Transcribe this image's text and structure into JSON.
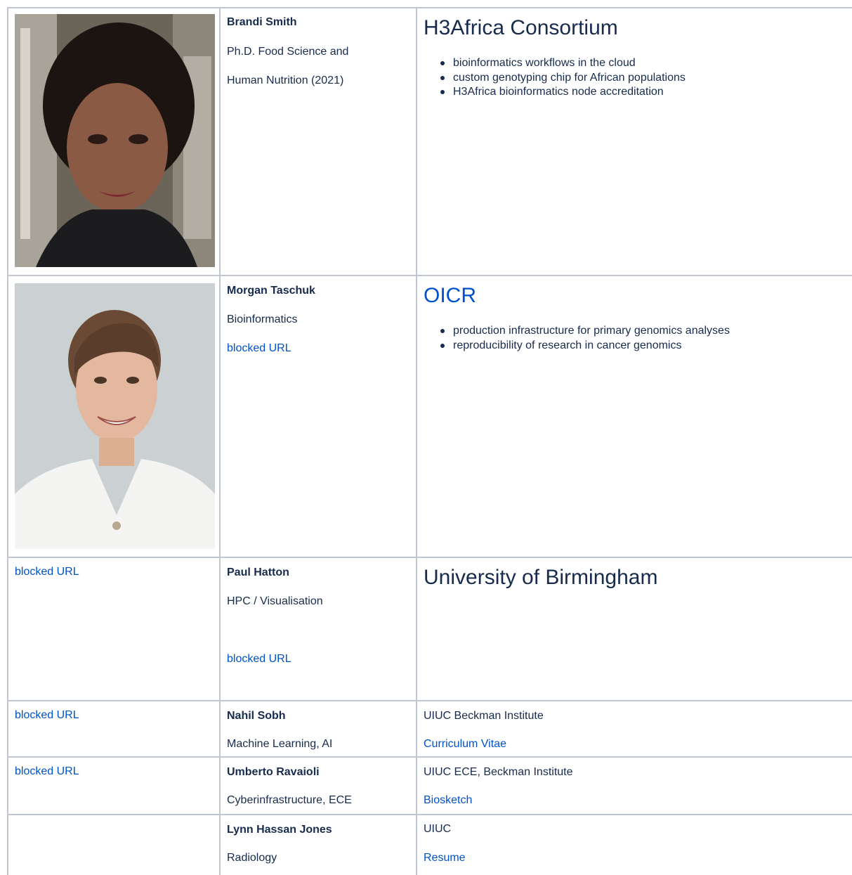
{
  "rows": [
    {
      "photo": "photo",
      "name": "Brandi Smith",
      "lines": [
        "Ph.D. Food Science and",
        "Human Nutrition (2021)"
      ],
      "org": "H3Africa Consortium",
      "bullets": [
        "bioinformatics workflows in the cloud",
        "custom genotyping chip for African populations",
        "H3Africa bioinformatics node accreditation"
      ]
    },
    {
      "photo": "photo",
      "name": "Morgan Taschuk",
      "lines": [
        "Bioinformatics"
      ],
      "link": "blocked URL",
      "org": "OICR",
      "bullets": [
        "production infrastructure for primary genomics analyses",
        "reproducibility of research in cancer genomics"
      ]
    },
    {
      "photo_link": "blocked URL",
      "name": "Paul Hatton",
      "lines": [
        "HPC / Visualisation"
      ],
      "link": "blocked URL",
      "org": "University of Birmingham"
    },
    {
      "photo_link": "blocked URL",
      "name": "Nahil Sobh",
      "lines": [
        "Machine Learning, AI"
      ],
      "org": "UIUC Beckman Institute",
      "org_link": "Curriculum Vitae"
    },
    {
      "photo_link": "blocked URL",
      "name": "Umberto Ravaioli",
      "lines": [
        "Cyberinfrastructure, ECE"
      ],
      "org": "UIUC ECE, Beckman Institute",
      "org_link": "Biosketch"
    },
    {
      "name": "Lynn Hassan Jones",
      "lines": [
        "Radiology"
      ],
      "org": "UIUC",
      "org_link": "Resume"
    }
  ],
  "colors": {
    "border": "#c1c7d0",
    "link": "#0052cc",
    "text": "#172b4d"
  }
}
